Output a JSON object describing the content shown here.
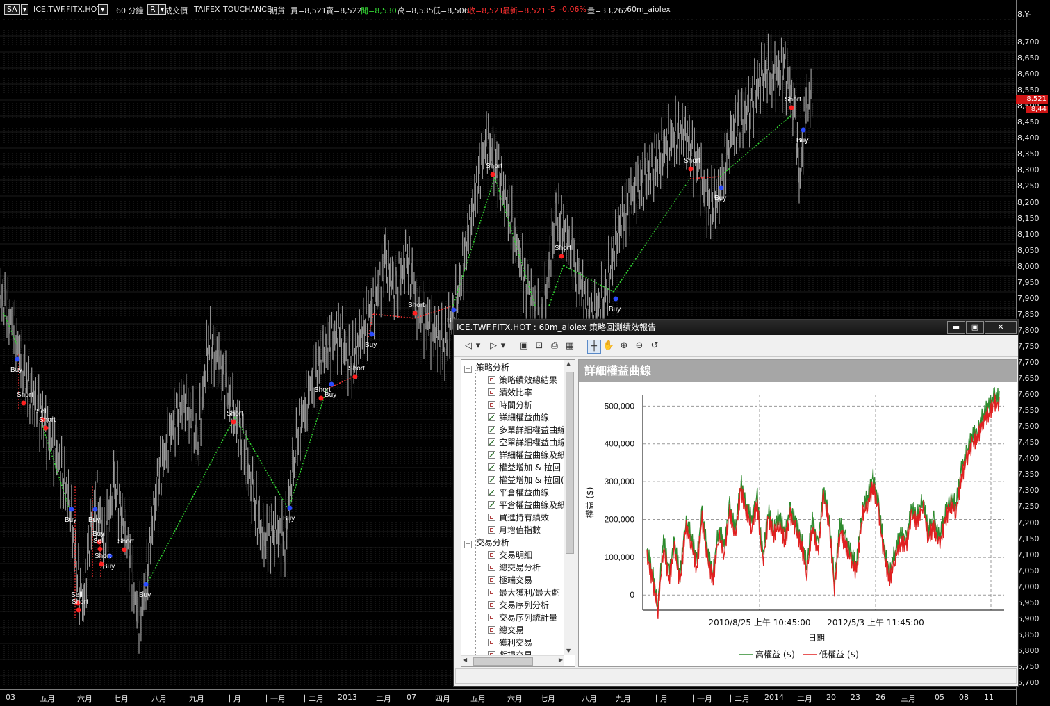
{
  "topbar": {
    "symbol_select": "SA",
    "symbol": "ICE.TWF.FITX.HOT",
    "period": "60 分鐘",
    "r_btn": "R",
    "field": "成交價",
    "exchange": "TAIFEX",
    "feed": "TOUCHANCE",
    "type": "期貨",
    "bid": "買=8,521",
    "ask": "賣=8,522",
    "open": "開=8,530",
    "high": "高=8,535",
    "low": "低=8,506",
    "close": "收=8,521",
    "last": "最新=8,521",
    "change": "-5",
    "change_pct": "-0.06%",
    "volume": "量=33,262",
    "strategy": "60m_aiolex",
    "colors": {
      "open": "#33d633",
      "close": "#ff3030"
    }
  },
  "y_axis": {
    "top_label": "8,Y-",
    "ticks": [
      "8,700",
      "8,650",
      "8,600",
      "8,550",
      "8,500",
      "8,450",
      "8,400",
      "8,350",
      "8,300",
      "8,250",
      "8,200",
      "8,150",
      "8,100",
      "8,050",
      "8,000",
      "7,950",
      "7,900",
      "7,850",
      "7,800",
      "7,750",
      "7,700",
      "7,650",
      "7,600",
      "7,550",
      "7,500",
      "7,450",
      "7,400",
      "7,350",
      "7,300",
      "7,250",
      "7,200",
      "7,150",
      "7,100",
      "7,050",
      "7,000",
      "6,950",
      "6,900",
      "6,850",
      "6,800",
      "6,750",
      "6,700"
    ],
    "price_tag": "8,521",
    "price_tag2": "8,44"
  },
  "x_axis": {
    "labels": [
      "03",
      "五月",
      "六月",
      "七月",
      "八月",
      "九月",
      "十月",
      "十一月",
      "十二月",
      "2013",
      "二月",
      "07",
      "四月",
      "五月",
      "六月",
      "七月",
      "八月",
      "九月",
      "十月",
      "十一月",
      "十二月",
      "2014",
      "二月",
      "20",
      "23",
      "26",
      "三月",
      "05",
      "08",
      "11"
    ]
  },
  "signals": [
    {
      "label": "Buy"
    },
    {
      "label": "Short"
    },
    {
      "label": "Buy"
    },
    {
      "label": "Sell"
    },
    {
      "label": "Short"
    },
    {
      "label": "Buy"
    },
    {
      "label": "Buy"
    },
    {
      "label": "Sell"
    },
    {
      "label": "Short"
    },
    {
      "label": "Buy"
    },
    {
      "label": "Short"
    },
    {
      "label": "Sell"
    },
    {
      "label": "Short"
    },
    {
      "label": "Buy"
    },
    {
      "label": "Short"
    },
    {
      "label": "Buy"
    },
    {
      "label": "Short"
    },
    {
      "label": "Buy"
    },
    {
      "label": "Short"
    },
    {
      "label": "Buy"
    },
    {
      "label": "Short"
    },
    {
      "label": "Buy"
    },
    {
      "label": "Short"
    },
    {
      "label": "Buy"
    },
    {
      "label": "Short"
    },
    {
      "label": "Buy"
    },
    {
      "label": "Short"
    },
    {
      "label": "Buy"
    },
    {
      "label": "Short"
    },
    {
      "label": "Buy"
    }
  ],
  "report": {
    "title": "ICE.TWF.FITX.HOT : 60m_aiolex 策略回測績效報告",
    "pane_title": "詳細權益曲線",
    "tree": {
      "group1": "策略分析",
      "items1": [
        "策略績效總結果",
        "績效比率",
        "時間分析",
        "詳細權益曲線",
        "多單詳細權益曲線",
        "空單詳細權益曲線",
        "詳細權益曲線及紙",
        "權益增加 & 拉回",
        "權益增加 & 拉回(",
        "平倉權益曲線",
        "平倉權益曲線及紙",
        "買進持有績效",
        "月增值指數"
      ],
      "group2": "交易分析",
      "items2": [
        "交易明細",
        "總交易分析",
        "極端交易",
        "最大獲利/最大虧",
        "交易序列分析",
        "交易序列統計量",
        "總交易",
        "獲利交易",
        "虧損交易"
      ]
    },
    "chart_data": {
      "type": "line",
      "title": "詳細權益曲線",
      "ylabel": "權益 ($)",
      "xlabel": "日期",
      "x_tick_labels": [
        "2010/8/25 上午 10:45:00",
        "2012/5/3 上午 11:45:00"
      ],
      "y_ticks": [
        "500,000",
        "400,000",
        "300,000",
        "200,000",
        "100,000",
        "0"
      ],
      "ylim": [
        -40000,
        530000
      ],
      "legend": [
        "高權益 ($)",
        "低權益 ($)"
      ],
      "legend_position": "bottom",
      "colors": {
        "high": "#2e8b2e",
        "low": "#e02020"
      },
      "series": [
        {
          "name": "高權益 ($)",
          "values": [
            120000,
            60000,
            -20000,
            150000,
            60000,
            140000,
            50000,
            200000,
            160000,
            90000,
            220000,
            110000,
            60000,
            180000,
            130000,
            240000,
            170000,
            300000,
            240000,
            200000,
            260000,
            100000,
            220000,
            180000,
            210000,
            160000,
            230000,
            190000,
            150000,
            80000,
            200000,
            130000,
            280000,
            210000,
            40000,
            190000,
            150000,
            110000,
            80000,
            230000,
            260000,
            310000,
            240000,
            120000,
            60000,
            120000,
            160000,
            150000,
            230000,
            210000,
            260000,
            170000,
            200000,
            150000,
            210000,
            260000,
            240000,
            330000,
            380000,
            420000,
            440000,
            480000,
            500000,
            530000,
            520000
          ]
        },
        {
          "name": "低權益 ($)",
          "values": [
            100000,
            40000,
            -40000,
            130000,
            40000,
            120000,
            30000,
            180000,
            140000,
            70000,
            200000,
            90000,
            40000,
            160000,
            110000,
            220000,
            150000,
            280000,
            220000,
            180000,
            240000,
            80000,
            200000,
            160000,
            190000,
            140000,
            210000,
            170000,
            130000,
            60000,
            180000,
            110000,
            260000,
            190000,
            20000,
            170000,
            130000,
            90000,
            60000,
            210000,
            240000,
            290000,
            220000,
            100000,
            40000,
            100000,
            140000,
            130000,
            210000,
            190000,
            240000,
            150000,
            180000,
            130000,
            190000,
            240000,
            220000,
            310000,
            360000,
            400000,
            420000,
            460000,
            480000,
            510000,
            500000
          ]
        }
      ]
    }
  }
}
